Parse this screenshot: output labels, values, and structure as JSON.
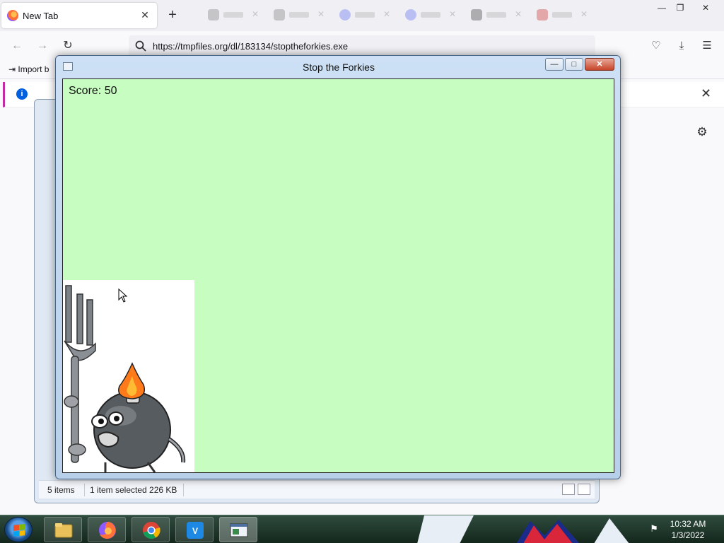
{
  "browser": {
    "tab_title": "New Tab",
    "tab_close": "✕",
    "new_tab": "+",
    "url": "https://tmpfiles.org/dl/183134/stoptheforkies.exe",
    "bookmark_import": "Import b",
    "win_min": "—",
    "win_max": "❐",
    "win_close": "✕",
    "infobar_icon": "i",
    "infobar_close": "✕"
  },
  "game": {
    "title": "Stop the Forkies",
    "score": "Score: 50",
    "btn_min": "—",
    "btn_max": "□",
    "btn_close": "✕"
  },
  "explorer": {
    "items": "5 items",
    "selection": "1 item selected  226 KB"
  },
  "taskbar": {
    "time": "10:32 AM",
    "date": "1/3/2022"
  },
  "colors": {
    "game_bg": "#c8fdc1",
    "flame": "#ff7a1a",
    "bomb": "#555a5e"
  },
  "icons": [
    "firefox-icon",
    "folder-icon",
    "chrome-icon",
    "vscode-icon",
    "app-window-icon",
    "search-icon",
    "gear-icon",
    "pocket-icon",
    "download-icon",
    "menu-icon"
  ]
}
